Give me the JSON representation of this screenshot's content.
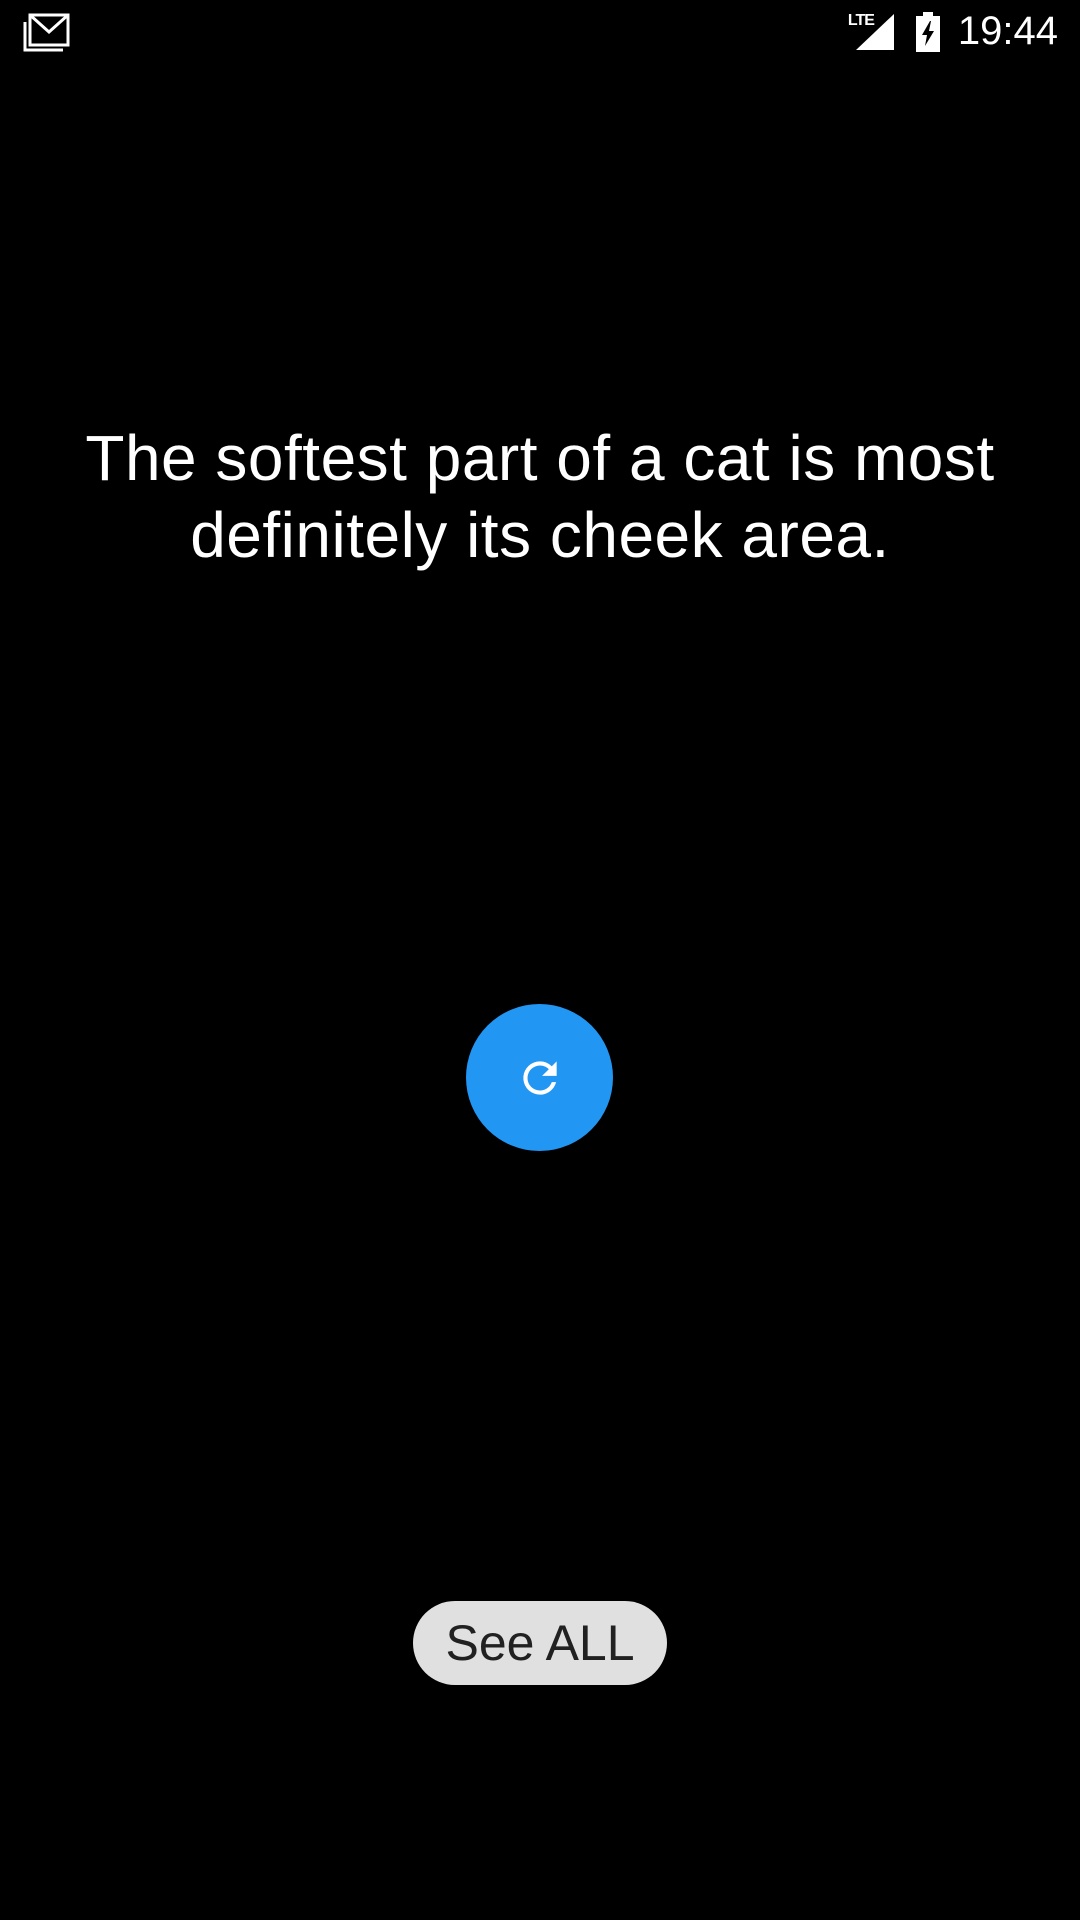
{
  "status_bar": {
    "notification_icon": "gmail-icon",
    "network_label": "LTE",
    "signal_icon": "cell-signal-icon",
    "battery_icon": "battery-charging-icon",
    "time": "19:44"
  },
  "main": {
    "fact_text": "The softest part of a cat is most definitely its cheek area.",
    "refresh_icon": "refresh-icon",
    "see_all_label": "See ALL"
  },
  "colors": {
    "background": "#000000",
    "text": "#ffffff",
    "accent": "#2196f3",
    "secondary_button": "#e0e0e0"
  }
}
